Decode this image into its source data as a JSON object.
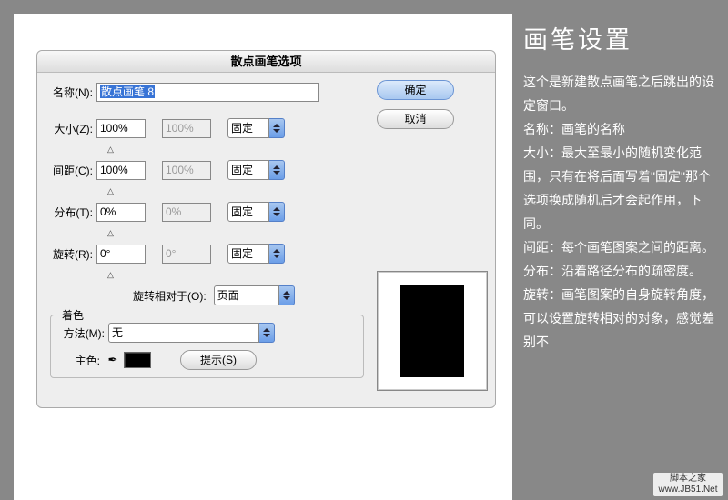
{
  "dialog": {
    "title": "散点画笔选项",
    "ok": "确定",
    "cancel": "取消",
    "name_label": "名称(N):",
    "name_value": "散点画笔 8",
    "rows": {
      "size": {
        "label": "大小(Z):",
        "v1": "100%",
        "v2": "100%",
        "mode": "固定"
      },
      "spacing": {
        "label": "间距(C):",
        "v1": "100%",
        "v2": "100%",
        "mode": "固定"
      },
      "scatter": {
        "label": "分布(T):",
        "v1": "0%",
        "v2": "0%",
        "mode": "固定"
      },
      "rotation": {
        "label": "旋转(R):",
        "v1": "0°",
        "v2": "0°",
        "mode": "固定"
      }
    },
    "rotation_relative": {
      "label": "旋转相对于(O):",
      "value": "页面"
    },
    "shading": {
      "legend": "着色",
      "method_label": "方法(M):",
      "method_value": "无",
      "key_label": "主色:",
      "hint": "提示(S)"
    }
  },
  "side": {
    "title": "画笔设置",
    "p1": "这个是新建散点画笔之后跳出的设定窗口。",
    "p2": "名称：画笔的名称",
    "p3": "大小：最大至最小的随机变化范围，只有在将后面写着\"固定\"那个选项换成随机后才会起作用，下同。",
    "p4": "间距：每个画笔图案之间的距离。",
    "p5": "分布：沿着路径分布的疏密度。",
    "p6": "旋转：画笔图案的自身旋转角度，可以设置旋转相对的对象，感觉差别不"
  },
  "watermark": {
    "l1": "脚本之家",
    "l2": "www.JB51.Net"
  }
}
